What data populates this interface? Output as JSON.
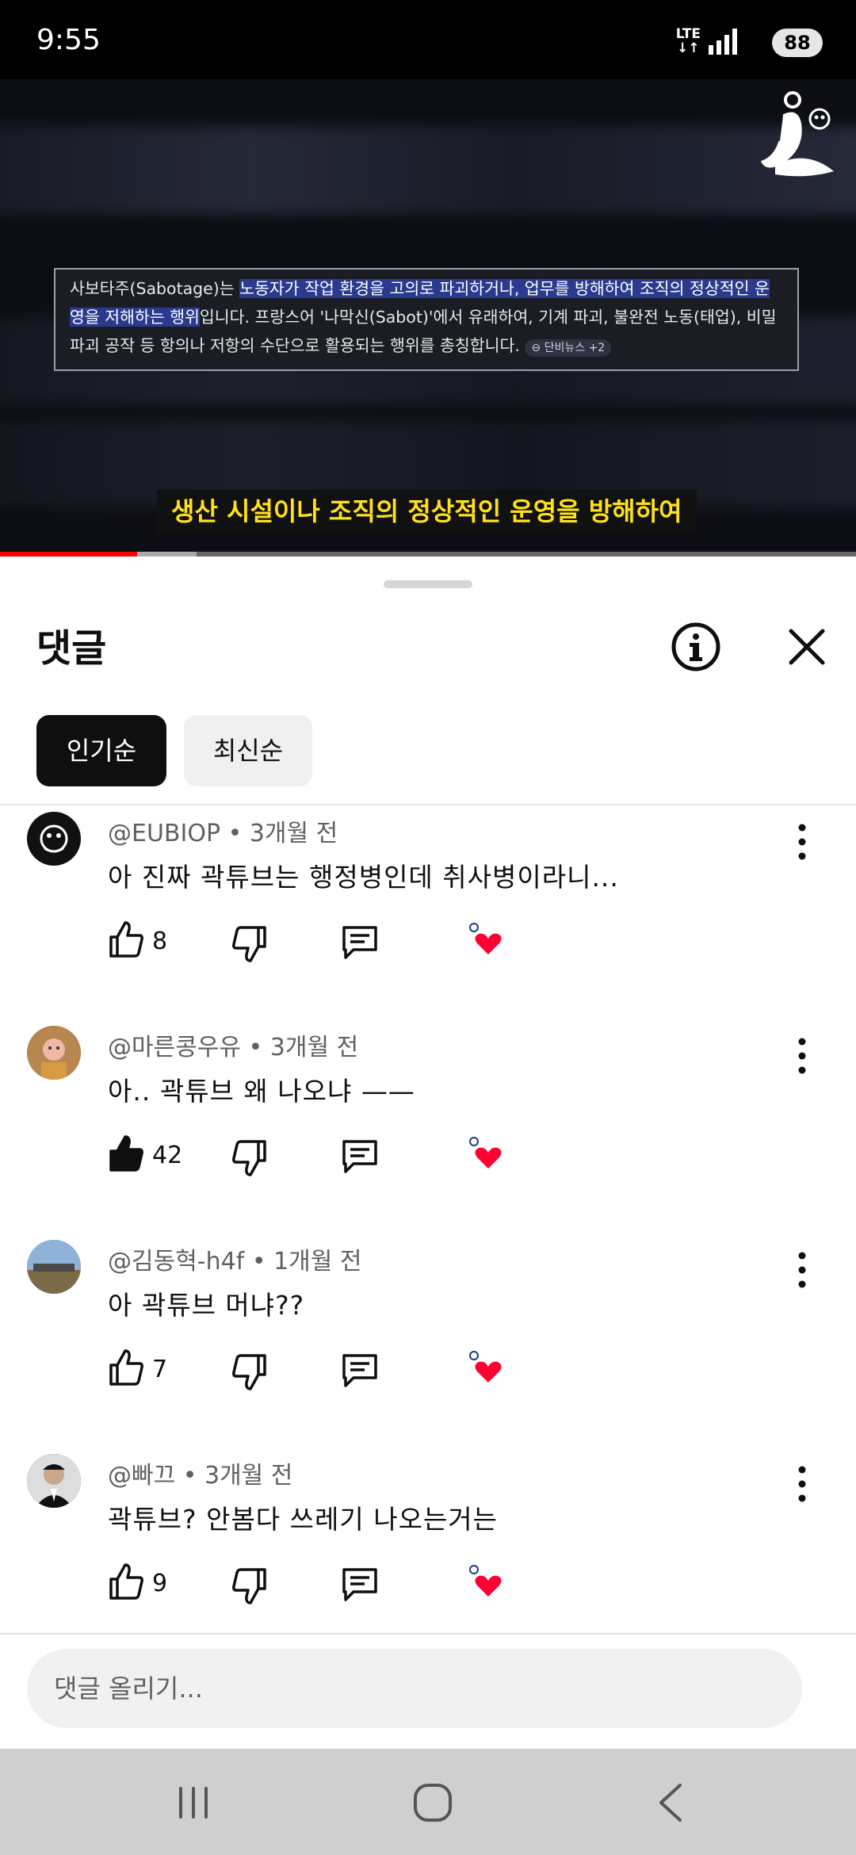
{
  "status_bar": {
    "time": "9:55",
    "network": "LTE",
    "battery": "88"
  },
  "video": {
    "explanation_plain1": "사보타주(Sabotage)는 ",
    "explanation_highlight": "노동자가 작업 환경을 고의로 파괴하거나, 업무를 방해하여 조직의 정상적인 운영을 저해하는 행위",
    "explanation_plain2": "입니다. 프랑스어 '나막신(Sabot)'에서 유래하여, 기계 파괴, 불완전 노동(태업), 비밀 파괴 공작 등 항의나 저항의 수단으로 활용되는 행위를 총칭합니다.",
    "source_chip": "단비뉴스 +2",
    "subtitle": "생산 시설이나 조직의 정상적인 운영을 방해하여",
    "progress_played": 0.16,
    "progress_buffered": 0.23
  },
  "sheet": {
    "title": "댓글",
    "chips": [
      "인기순",
      "최신순"
    ],
    "comments": [
      {
        "author": "@EUBIOP",
        "age": "3개월 전",
        "text": "아 진짜 곽튜브는 행정병인데 취사병이라니...",
        "likes": "8",
        "liked": false,
        "avatar_color": "#111111"
      },
      {
        "author": "@마른콩우유",
        "age": "3개월 전",
        "text": "아.. 곽튜브 왜 나오냐 ——",
        "likes": "42",
        "liked": true,
        "avatar_color": "#c48a52"
      },
      {
        "author": "@김동혁-h4f",
        "age": "1개월 전",
        "text": "아 곽튜브 머냐??",
        "likes": "7",
        "liked": false,
        "avatar_color": "#6d8db0"
      },
      {
        "author": "@빠끄",
        "age": "3개월 전",
        "text": "곽튜브? 안봄다 쓰레기 나오는거는",
        "likes": "9",
        "liked": false,
        "avatar_color": "#222222"
      }
    ],
    "add_placeholder": "댓글 올리기..."
  }
}
